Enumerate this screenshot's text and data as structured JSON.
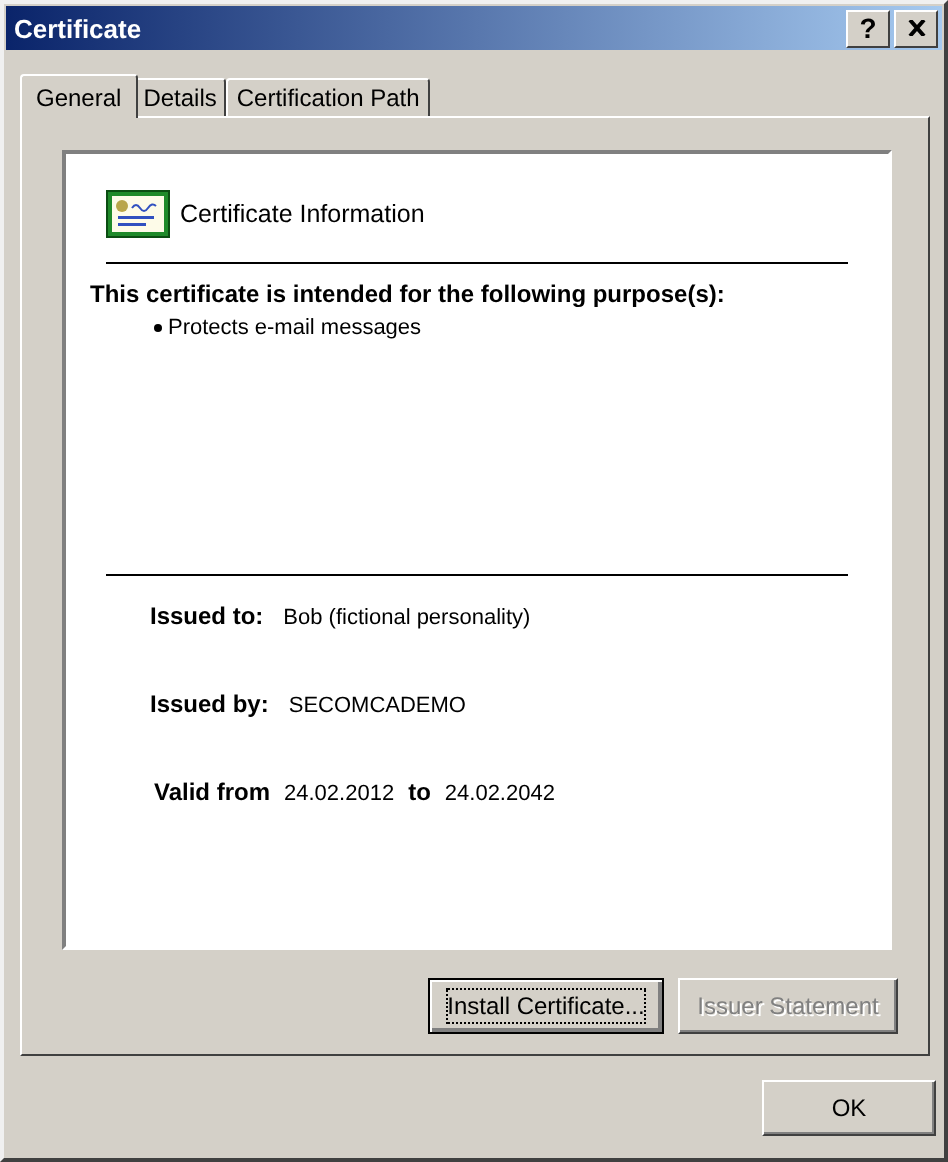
{
  "window": {
    "title": "Certificate",
    "help_button": "?"
  },
  "tabs": [
    {
      "label": "General",
      "selected": true
    },
    {
      "label": "Details",
      "selected": false
    },
    {
      "label": "Certification Path",
      "selected": false
    }
  ],
  "info": {
    "heading": "Certificate Information",
    "purpose_intro": "This certificate is intended for the following purpose(s):",
    "purposes": [
      "Protects e-mail messages"
    ],
    "issued_to": {
      "label": "Issued to:",
      "value": "Bob (fictional personality)"
    },
    "issued_by": {
      "label": "Issued by:",
      "value": "SECOMCADEMO"
    },
    "validity": {
      "label": "Valid from",
      "from": "24.02.2012",
      "separator": "to",
      "to": "24.02.2042"
    }
  },
  "panel_buttons": [
    {
      "label": "Install Certificate...",
      "disabled": false,
      "focused": true
    },
    {
      "label": "Issuer Statement",
      "disabled": true,
      "focused": false
    }
  ],
  "dialog_buttons": [
    {
      "label": "OK",
      "disabled": false
    }
  ]
}
